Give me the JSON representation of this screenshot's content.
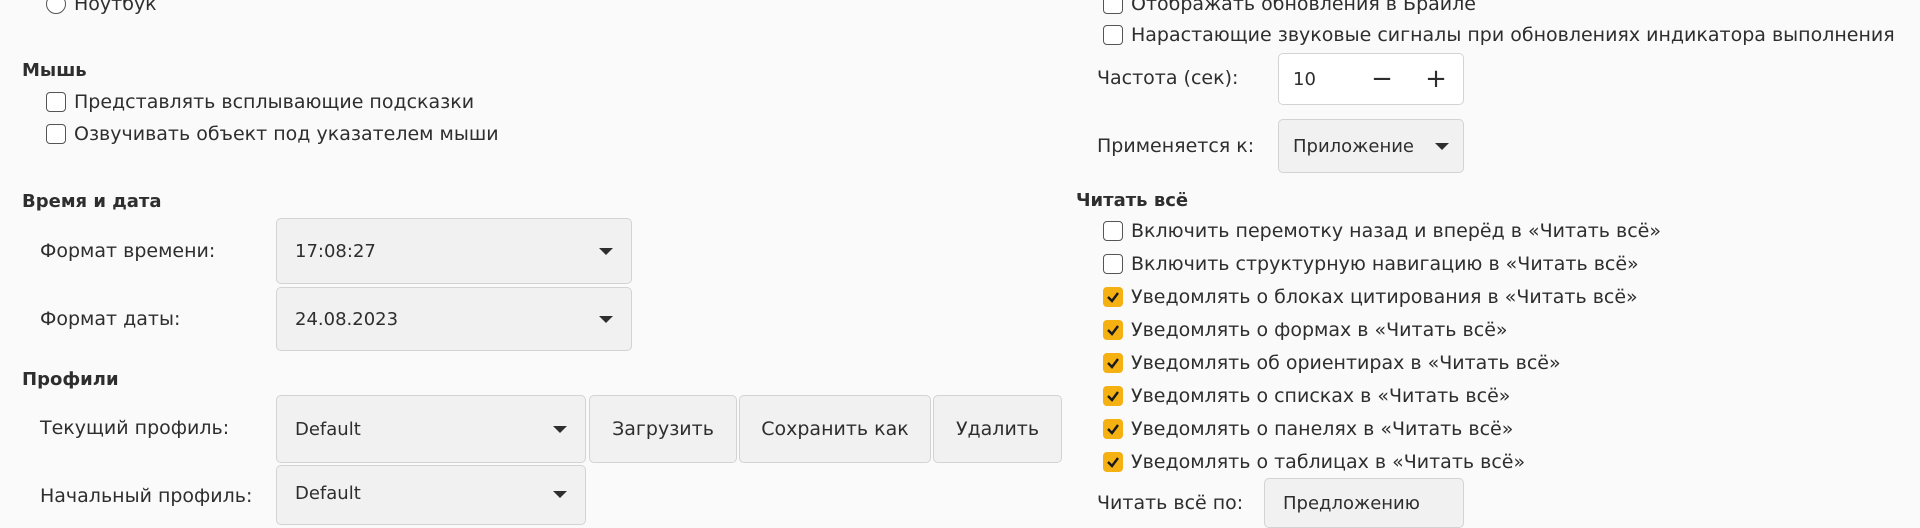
{
  "left": {
    "laptop_radio_label": "Ноутбук",
    "mouse": {
      "heading": "Мышь",
      "options": [
        {
          "label": "Представлять всплывающие подсказки",
          "checked": false
        },
        {
          "label": "Озвучивать объект под указателем мыши",
          "checked": false
        }
      ]
    },
    "datetime": {
      "heading": "Время и дата",
      "time_format_label": "Формат времени:",
      "time_format_value": "17:08:27",
      "date_format_label": "Формат даты:",
      "date_format_value": "24.08.2023"
    },
    "profiles": {
      "heading": "Профили",
      "current_label": "Текущий профиль:",
      "current_value": "Default",
      "load_button": "Загрузить",
      "save_as_button": "Сохранить как",
      "delete_button": "Удалить",
      "startup_label": "Начальный профиль:",
      "startup_value": "Default"
    }
  },
  "right": {
    "progress_options": [
      {
        "label": "Отображать обновления в Брайле",
        "checked": false
      },
      {
        "label": "Нарастающие звуковые сигналы при обновлениях индикатора выполнения",
        "checked": false
      }
    ],
    "frequency_label": "Частота (сек):",
    "frequency_value": "10",
    "minus_symbol": "−",
    "plus_symbol": "+",
    "applies_label": "Применяется к:",
    "applies_value": "Приложение",
    "say_all": {
      "heading": "Читать всё",
      "options": [
        {
          "label": "Включить перемотку назад и вперёд в «Читать всё»",
          "checked": false
        },
        {
          "label": "Включить структурную навигацию в «Читать всё»",
          "checked": false
        },
        {
          "label": "Уведомлять о блоках цитирования в «Читать всё»",
          "checked": true
        },
        {
          "label": "Уведомлять о формах в «Читать всё»",
          "checked": true
        },
        {
          "label": "Уведомлять об ориентирах в «Читать всё»",
          "checked": true
        },
        {
          "label": "Уведомлять о списках в «Читать всё»",
          "checked": true
        },
        {
          "label": "Уведомлять о панелях в «Читать всё»",
          "checked": true
        },
        {
          "label": "Уведомлять о таблицах в «Читать всё»",
          "checked": true
        }
      ],
      "say_by_label": "Читать всё по:",
      "say_by_value": "Предложению"
    },
    "accent_color": "#f5b012"
  }
}
